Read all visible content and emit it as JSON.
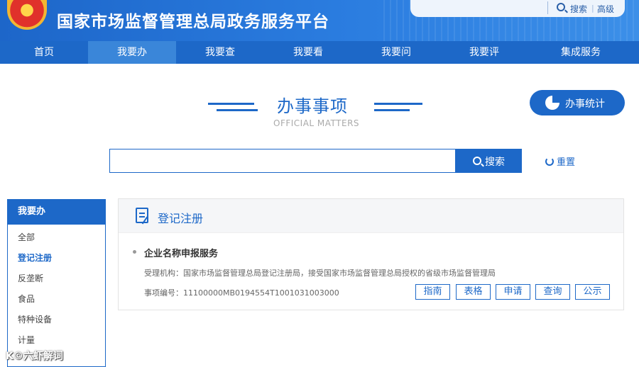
{
  "header": {
    "site_title": "国家市场监督管理总局政务服务平台",
    "search_label": "搜索",
    "search_separator": "|",
    "advanced_label": "高级"
  },
  "nav": {
    "items": [
      "首页",
      "我要办",
      "我要查",
      "我要看",
      "我要问",
      "我要评",
      "集成服务"
    ],
    "active_index": 1
  },
  "section": {
    "title": "办事事项",
    "subtitle": "OFFICIAL MATTERS",
    "stats_label": "办事统计"
  },
  "search": {
    "value": "",
    "placeholder": "",
    "button_label": "搜索",
    "reset_label": "重置"
  },
  "sidebar": {
    "header": "我要办",
    "items": [
      "全部",
      "登记注册",
      "反垄断",
      "食品",
      "特种设备",
      "计量"
    ],
    "active_index": 1
  },
  "panel": {
    "category_title": "登记注册",
    "service": {
      "name": "企业名称申报服务",
      "agency": "受理机构：国家市场监督管理总局登记注册局，接受国家市场监督管理总局授权的省级市场监督管理局",
      "code": "事项编号：11100000MB0194554T1001031003000",
      "actions": [
        "指南",
        "表格",
        "申请",
        "查询",
        "公示"
      ]
    }
  },
  "watermark": "K©六虾解词",
  "colors": {
    "primary": "#1d68c8",
    "nav_active": "#3a86d9"
  }
}
